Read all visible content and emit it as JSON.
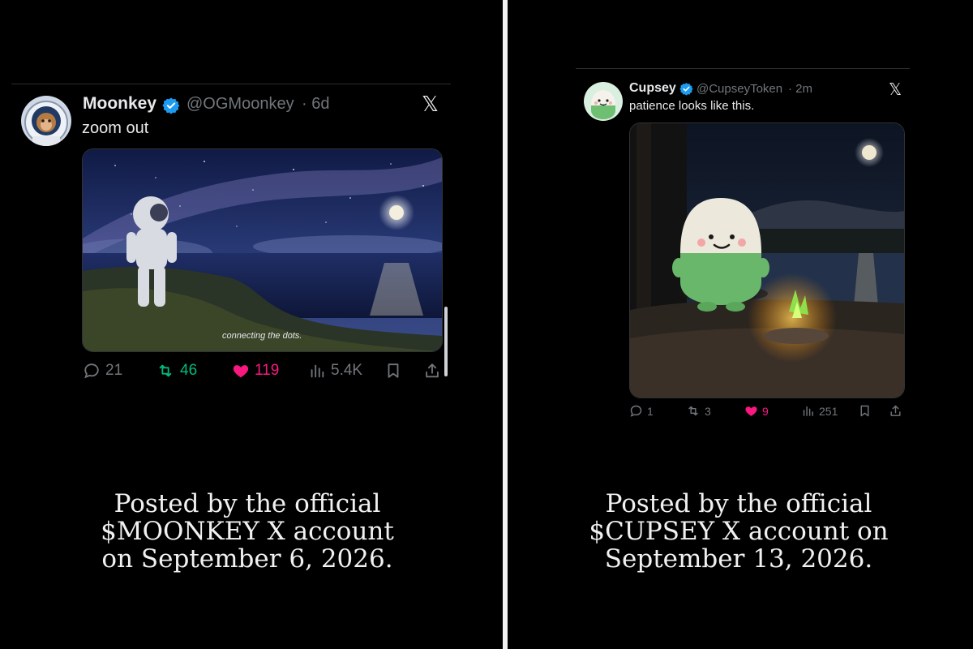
{
  "left_post": {
    "name": "Moonkey",
    "handle": "@OGMoonkey",
    "time": "· 6d",
    "text": "zoom out",
    "media_caption": "connecting the dots.",
    "stats": {
      "replies": "21",
      "reposts": "46",
      "likes": "119",
      "views": "5.4K"
    },
    "liked": true,
    "footer": [
      "Posted by the official",
      "$MOONKEY X account",
      "on September 6, 2026."
    ]
  },
  "right_post": {
    "name": "Cupsey",
    "handle": "@CupseyToken",
    "time": "· 2m",
    "text": "patience looks like this.",
    "stats": {
      "replies": "1",
      "reposts": "3",
      "likes": "9",
      "views": "251"
    },
    "liked": true,
    "footer": [
      "Posted by the official",
      "$CUPSEY X account on",
      "September 13, 2026."
    ]
  },
  "icons": {
    "platform": "x-logo-icon",
    "verified": "verified-badge-icon",
    "reply": "reply-icon",
    "repost": "repost-icon",
    "like": "heart-icon",
    "views": "views-icon",
    "bookmark": "bookmark-icon",
    "share": "share-icon"
  },
  "colors": {
    "background": "#000000",
    "text": "#e7e9ea",
    "muted": "#71767b",
    "verified": "#1d9bf0",
    "repost": "#00ba7c",
    "like": "#f91880"
  }
}
